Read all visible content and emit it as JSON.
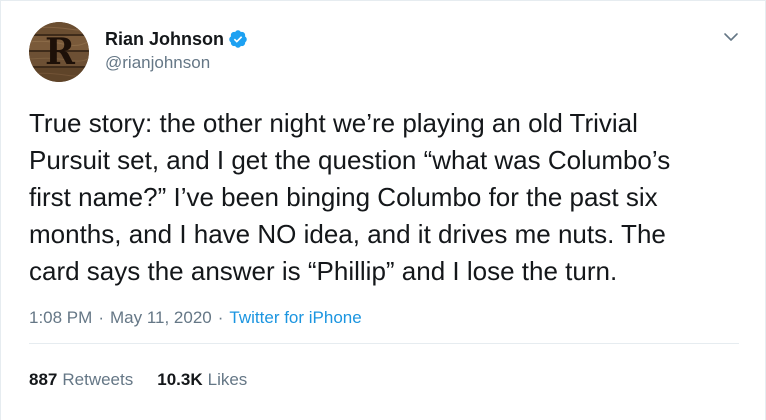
{
  "author": {
    "name": "Rian Johnson",
    "handle": "@rianjohnson",
    "avatar_letter": "R",
    "verified": true
  },
  "tweet": {
    "lines": [
      "True story: the other night we’re playing an old Trivial",
      "Pursuit set, and I get the question “what was Columbo’s",
      "first name?” I’ve been binging Columbo for the past six",
      "months, and I have NO idea, and it drives me nuts. The",
      "card says the answer is “Phillip” and I lose the turn."
    ]
  },
  "meta": {
    "time": "1:08 PM",
    "separator": "·",
    "date": "May 11, 2020",
    "source": "Twitter for iPhone"
  },
  "stats": {
    "retweets_count": "887",
    "retweets_label": "Retweets",
    "likes_count": "10.3K",
    "likes_label": "Likes"
  },
  "icons": {
    "verified": "verified-badge-icon",
    "caret": "chevron-down-icon"
  },
  "colors": {
    "text": "#14171a",
    "secondary": "#657786",
    "link": "#1b95e0",
    "verified": "#1da1f2",
    "border": "#e6ecf0"
  }
}
